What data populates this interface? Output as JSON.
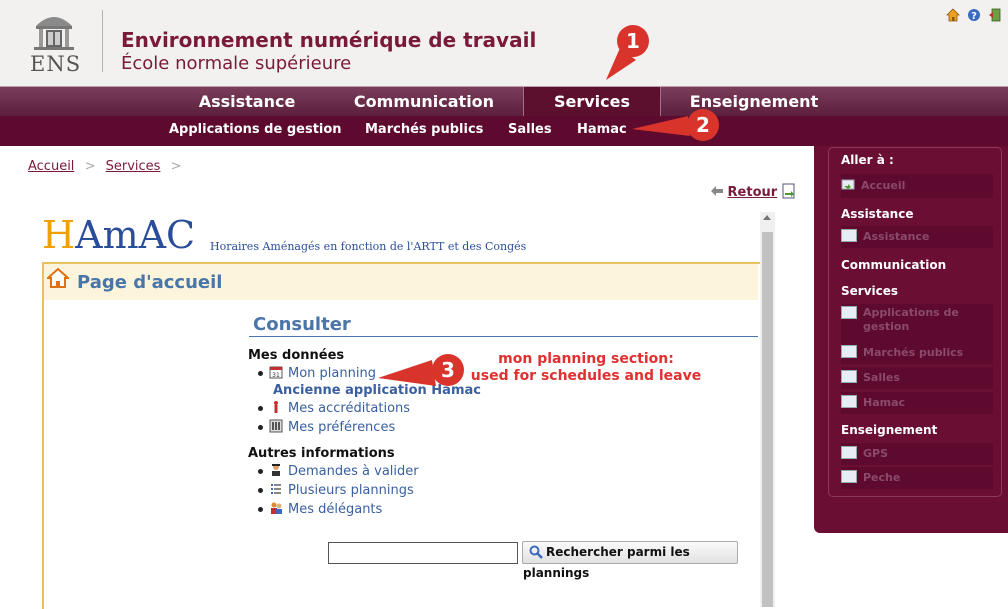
{
  "header": {
    "logo_text": "ENS",
    "title": "Environnement numérique de travail",
    "subtitle": "École normale supérieure",
    "top_icons": [
      "home-icon",
      "help-icon",
      "logout-icon"
    ]
  },
  "nav_primary": {
    "items": [
      {
        "label": "Assistance"
      },
      {
        "label": "Communication"
      },
      {
        "label": "Services",
        "active": true
      },
      {
        "label": "Enseignement"
      }
    ]
  },
  "nav_secondary": {
    "items": [
      {
        "label": "Applications de gestion"
      },
      {
        "label": "Marchés publics"
      },
      {
        "label": "Salles"
      },
      {
        "label": "Hamac"
      }
    ]
  },
  "breadcrumb": {
    "items": [
      "Accueil",
      "Services"
    ],
    "sep": ">"
  },
  "retour": {
    "label": "Retour"
  },
  "hamac": {
    "logo_h": "H",
    "logo_rest": "AmAC",
    "tagline": "Horaires Aménagés en fonction de l'ARTT et des Congés",
    "page_title": "Page d'accueil",
    "section_title": "Consulter",
    "mes_donnees": {
      "heading": "Mes données",
      "items": [
        "Mon planning",
        "Ancienne application Hamac",
        "Mes accréditations",
        "Mes préférences"
      ]
    },
    "autres": {
      "heading": "Autres informations",
      "items": [
        "Demandes à valider",
        "Plusieurs plannings",
        "Mes délégants"
      ]
    },
    "search": {
      "value": "",
      "button": "Rechercher parmi les plannings"
    }
  },
  "sidebar": {
    "title": "Aller à :",
    "accueil": "Accueil",
    "groups": [
      {
        "heading": "Assistance",
        "items": [
          "Assistance"
        ]
      },
      {
        "heading": "Communication",
        "items": []
      },
      {
        "heading": "Services",
        "items": [
          "Applications de gestion",
          "Marchés publics",
          "Salles",
          "Hamac"
        ]
      },
      {
        "heading": "Enseignement",
        "items": [
          "GPS",
          "Peche"
        ]
      }
    ]
  },
  "annotations": {
    "badge1": "1",
    "badge2": "2",
    "badge3": "3",
    "note": "mon planning section:\nused for schedules and leave",
    "color": "#d9342b"
  }
}
